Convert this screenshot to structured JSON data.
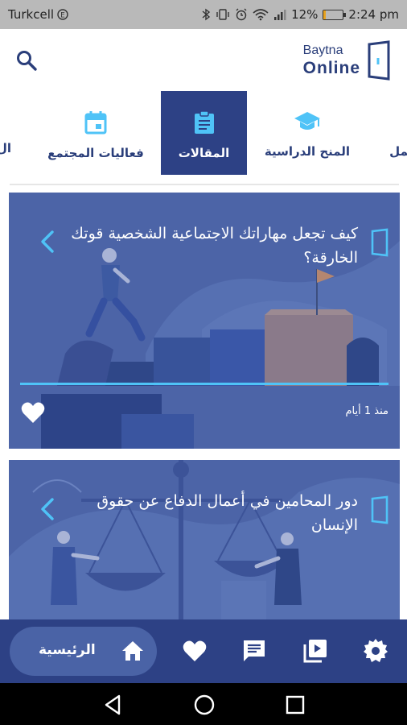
{
  "status_bar": {
    "carrier": "Turkcell",
    "carrier_icon": "e-data-icon",
    "icons": [
      "bluetooth-icon",
      "vibrate-icon",
      "alarm-icon",
      "wifi-icon",
      "signal-icon"
    ],
    "battery_percent": "12%",
    "battery_level": 0.12,
    "time": "2:24 pm"
  },
  "header": {
    "search_icon": "search-icon",
    "logo_line1": "Baytna",
    "logo_line2": "Online",
    "logo_icon": "door-logo-icon"
  },
  "tabs": [
    {
      "label": "عمل",
      "icon": "work-icon",
      "active": false
    },
    {
      "label": "المنح الدراسية",
      "icon": "graduation-cap-icon",
      "active": false
    },
    {
      "label": "المقالات",
      "icon": "clipboard-icon",
      "active": true
    },
    {
      "label": "فعاليات المجتمع",
      "icon": "calendar-icon",
      "active": false
    },
    {
      "label": "ال",
      "icon": "",
      "active": false
    }
  ],
  "cards": [
    {
      "title": "كيف تجعل مهاراتك الاجتماعية الشخصية قوتك الخارقة؟",
      "time": "منذ 1 أيام",
      "favorite_icon": "heart-icon",
      "illustration": "person-climbing-bar-chart-illustration"
    },
    {
      "title": "دور المحامين في أعمال الدفاع عن حقوق الإنسان",
      "illustration": "justice-scales-illustration"
    }
  ],
  "bottom_nav": {
    "home_label": "الرئيسية",
    "items": [
      "home-icon",
      "heart-icon",
      "chat-icon",
      "video-library-icon",
      "settings-icon"
    ]
  },
  "colors": {
    "primary": "#2d4185",
    "primary_light": "#4a63a6",
    "accent": "#4fc3f7",
    "status_bar": "#b9b9b9"
  }
}
